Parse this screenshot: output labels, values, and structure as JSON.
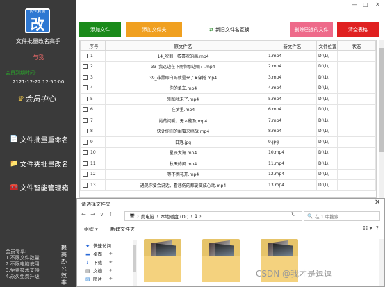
{
  "app": {
    "logo_text": "ECE·FUN",
    "logo_char": "改",
    "title": "文件批量改名高手",
    "user": "与我",
    "expiry_label": "会员到期时间:",
    "expiry_date": "2121-12-22 12:50:00",
    "vip_label": "会员中心",
    "window_controls": [
      "—",
      "□",
      "✕"
    ]
  },
  "sidebar": {
    "items": [
      {
        "label": "文件批量重命名",
        "icon": "document-icon",
        "active": true
      },
      {
        "label": "文件夹批量改名",
        "icon": "folder-icon",
        "active": false
      },
      {
        "label": "文件智能管理箱",
        "icon": "toolbox-icon",
        "active": false
      }
    ],
    "notes": [
      "会员专享:",
      "1.不限文件数量",
      "2.不限电脑使用",
      "3.免费技术支持",
      "4.永久免费升级"
    ],
    "side_text": "提高办公效率"
  },
  "toolbar": {
    "add_file": "添加文件",
    "add_folder": "添加文件夹",
    "swap_names": "新旧文件名互换",
    "delete_selected": "删除已选的文件",
    "clear_list": "清空表格",
    "colors": {
      "add_file": "#1a8a1a",
      "add_folder": "#f0a020",
      "delete_selected": "#ee6a8a",
      "clear_list": "#e02020"
    }
  },
  "table": {
    "headers": [
      "序号",
      "原文件名",
      "新文件名",
      "文件位置",
      "状态"
    ],
    "rows": [
      {
        "no": "1",
        "orig": "14_吹到一幅喜欢的画.mp4",
        "new": "1.mp4",
        "loc": "D:\\1\\"
      },
      {
        "no": "2",
        "orig": "33_我这边在下雨你那边呢？.mp4",
        "new": "2.mp4",
        "loc": "D:\\1\\"
      },
      {
        "no": "3",
        "orig": "39_非黑即白吗就是来了#穿搭.mp4",
        "new": "3.mp4",
        "loc": "D:\\1\\"
      },
      {
        "no": "4",
        "orig": "你的单车.mp4",
        "new": "4.mp4",
        "loc": "D:\\1\\"
      },
      {
        "no": "5",
        "orig": "别怕我来了.mp4",
        "new": "5.mp4",
        "loc": "D:\\1\\"
      },
      {
        "no": "6",
        "orig": "在梦里.mp4",
        "new": "6.mp4",
        "loc": "D:\\1\\"
      },
      {
        "no": "7",
        "orig": "她的问爱，无人能及.mp4",
        "new": "7.mp4",
        "loc": "D:\\1\\"
      },
      {
        "no": "8",
        "orig": "快让你们的闺蜜来挑战.mp4",
        "new": "8.mp4",
        "loc": "D:\\1\\"
      },
      {
        "no": "9",
        "orig": "日落.jpg",
        "new": "9.jpg",
        "loc": "D:\\1\\"
      },
      {
        "no": "10",
        "orig": "星辰大海.mp4",
        "new": "10.mp4",
        "loc": "D:\\1\\"
      },
      {
        "no": "11",
        "orig": "秋天的风.mp4",
        "new": "11.mp4",
        "loc": "D:\\1\\"
      },
      {
        "no": "12",
        "orig": "等不到花开.mp4",
        "new": "12.mp4",
        "loc": "D:\\1\\"
      },
      {
        "no": "13",
        "orig": "遇见你要会说话，看悲伤的都要变成心动.mp4",
        "new": "13.mp4",
        "loc": "D:\\1\\"
      }
    ]
  },
  "dialog": {
    "title": "请选择文件夹",
    "close": "✕",
    "nav_buttons": [
      "←",
      "→",
      "∨",
      "↑"
    ],
    "breadcrumb": [
      "此电脑",
      "本地磁盘 (D:)",
      "1"
    ],
    "search_placeholder": "在 1 中搜索",
    "organize": "组织 ▾",
    "new_folder": "新建文件夹",
    "tree": [
      {
        "label": "快速访问",
        "icon": "star-icon"
      },
      {
        "label": "桌面",
        "icon": "desktop-icon"
      },
      {
        "label": "下载",
        "icon": "download-icon"
      },
      {
        "label": "文档",
        "icon": "document-icon"
      },
      {
        "label": "图片",
        "icon": "picture-icon"
      }
    ],
    "folder_count": 3
  },
  "watermark": "CSDN @我才是逗逗"
}
